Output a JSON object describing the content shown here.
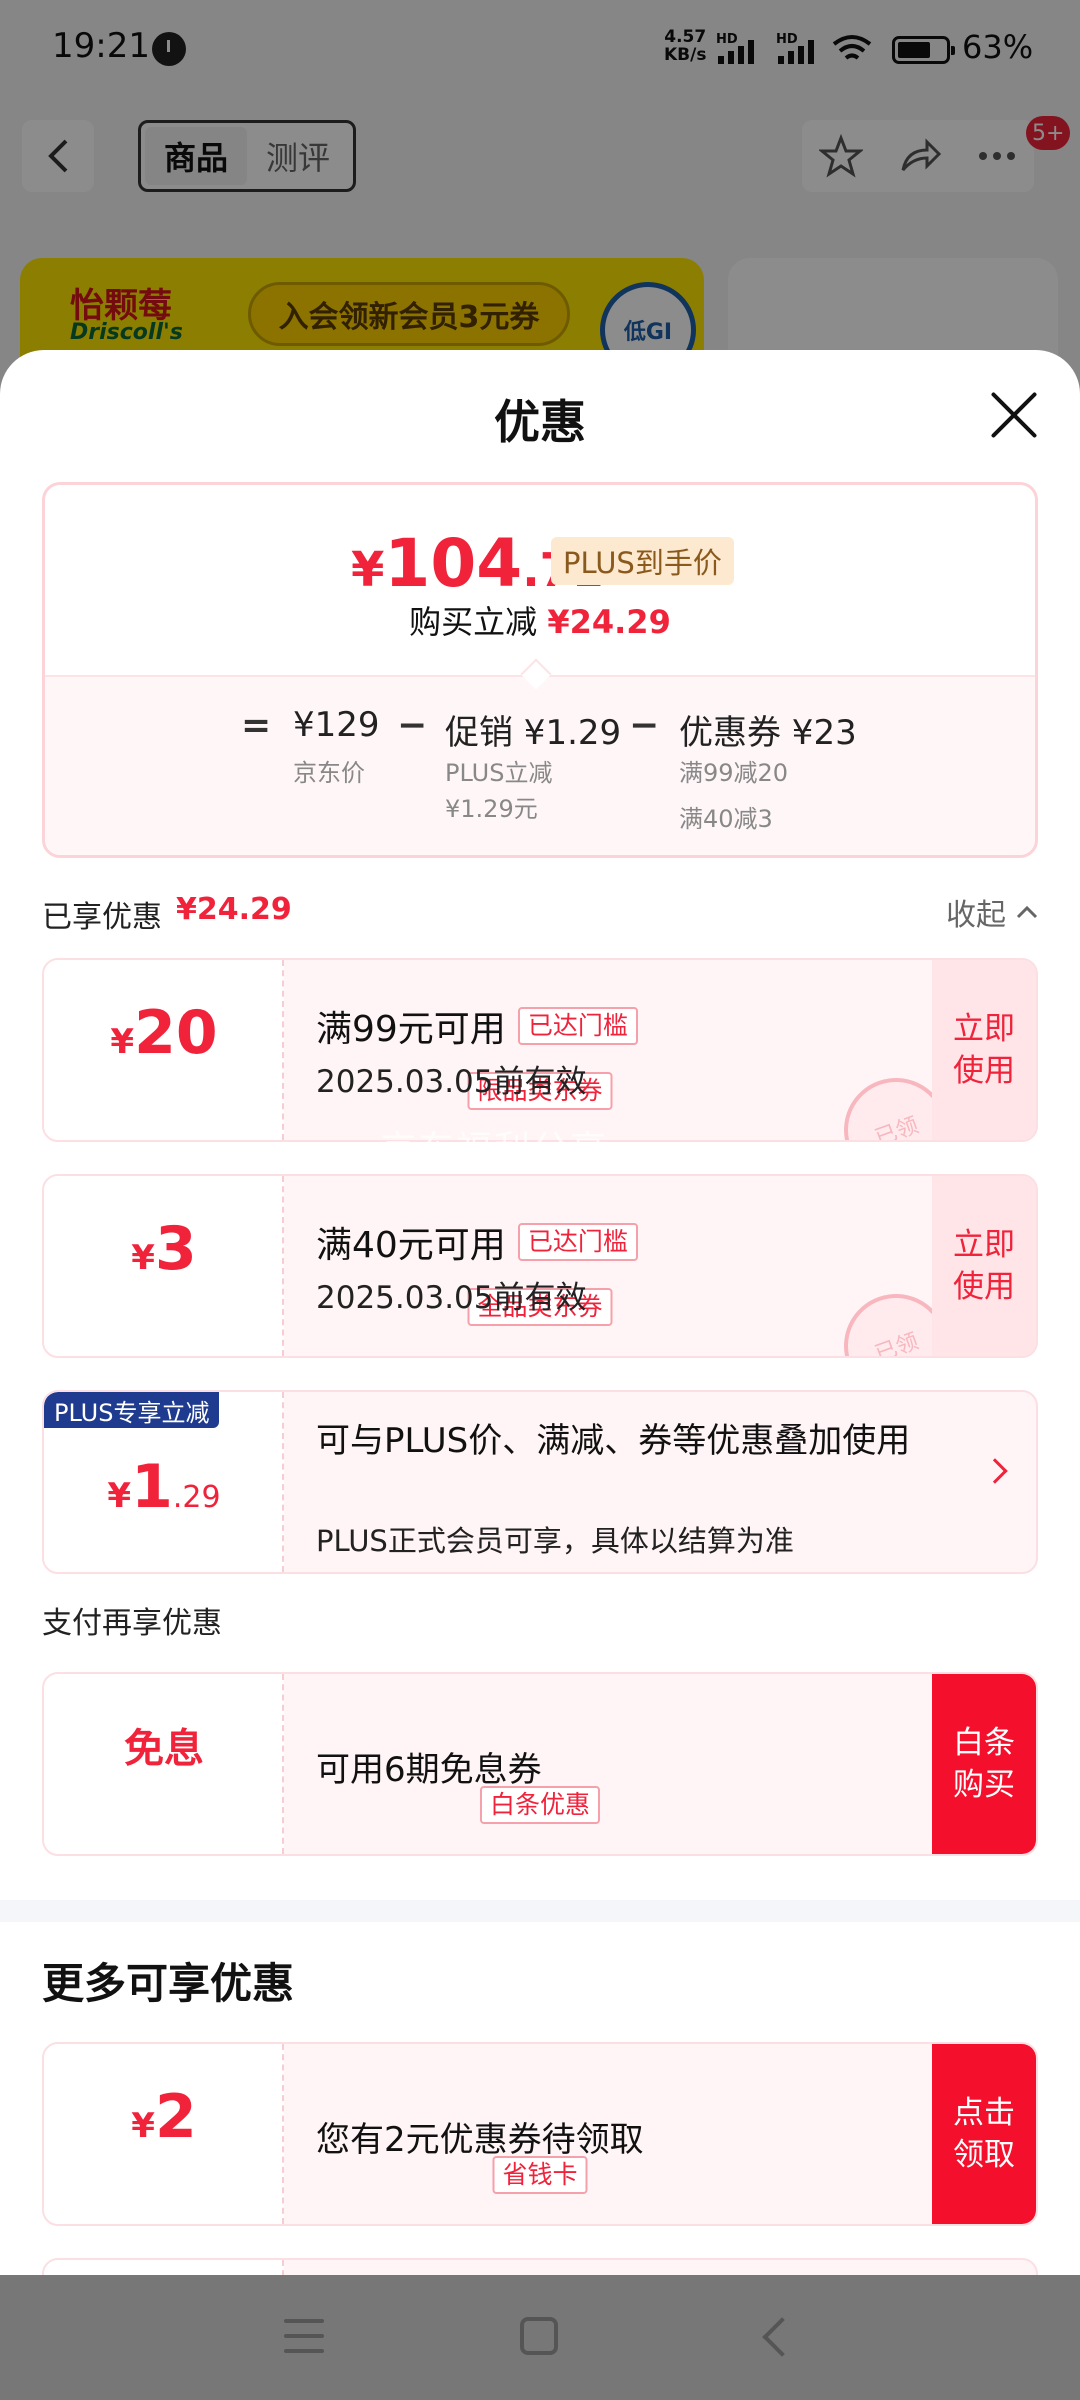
{
  "status_bar": {
    "time": "19:21",
    "net_speed_value": "4.57",
    "net_speed_unit": "KB/s",
    "signal1_label": "HD",
    "signal2_label": "HD",
    "wifi_label": "6",
    "battery_pct": "63%"
  },
  "top_nav": {
    "tabs": [
      "商品",
      "测评"
    ],
    "active_tab": "商品",
    "badge": "5+"
  },
  "banner": {
    "logo": "怡颗莓",
    "logo_sub": "Driscoll's",
    "promo": "入会领新会员3元券",
    "seal": "低GI"
  },
  "sheet": {
    "title": "优惠",
    "summary": {
      "price_symbol": "¥",
      "price_int": "104",
      "price_dec": ".71",
      "plus_tag": "PLUS到手价",
      "saved_label": "购买立减",
      "saved_amount": "¥24.29",
      "calc": {
        "eq": "=",
        "minus": "−",
        "base_value": "¥129",
        "base_label": "京东价",
        "promo_value": "促销 ¥1.29",
        "promo_sub1": "PLUS立减",
        "promo_sub2": "¥1.29元",
        "coupon_value": "优惠券 ¥23",
        "coupon_sub1": "满99减20",
        "coupon_sub2": "满40减3"
      }
    },
    "enjoyed": {
      "label": "已享优惠",
      "amount": "¥24.29",
      "collapse_label": "收起"
    },
    "coupons": [
      {
        "symbol": "¥",
        "amount": "20",
        "tag": "限品类东券",
        "condition": "满99元可用",
        "reached": "已达门槛",
        "validity": "2025.03.05前有效",
        "action": "立即使用",
        "stamp": "已领"
      },
      {
        "symbol": "¥",
        "amount": "3",
        "tag": "全品类东券",
        "condition": "满40元可用",
        "reached": "已达门槛",
        "validity": "2025.03.05前有效",
        "action": "立即使用",
        "stamp": "已领"
      }
    ],
    "plus_card": {
      "ribbon": "PLUS专享立减",
      "symbol": "¥",
      "amount_int": "1",
      "amount_dec": ".29",
      "desc": "可与PLUS价、满减、券等优惠叠加使用",
      "note": "PLUS正式会员可享，具体以结算为准"
    },
    "pay_section_title": "支付再享优惠",
    "baitiao_card": {
      "amount": "免息",
      "tag": "白条优惠",
      "desc": "可用6期免息券",
      "action": "白条购买"
    },
    "more_title": "更多可享优惠",
    "more_card": {
      "symbol": "¥",
      "amount": "2",
      "tag": "省钱卡",
      "desc": "您有2元优惠券待领取",
      "action": "点击领取"
    },
    "watermark": "京东福利分享"
  },
  "colors": {
    "accent_red": "#f0233b",
    "plus_blue": "#1f3b8f",
    "plus_gold_bg": "#fde9cf"
  }
}
